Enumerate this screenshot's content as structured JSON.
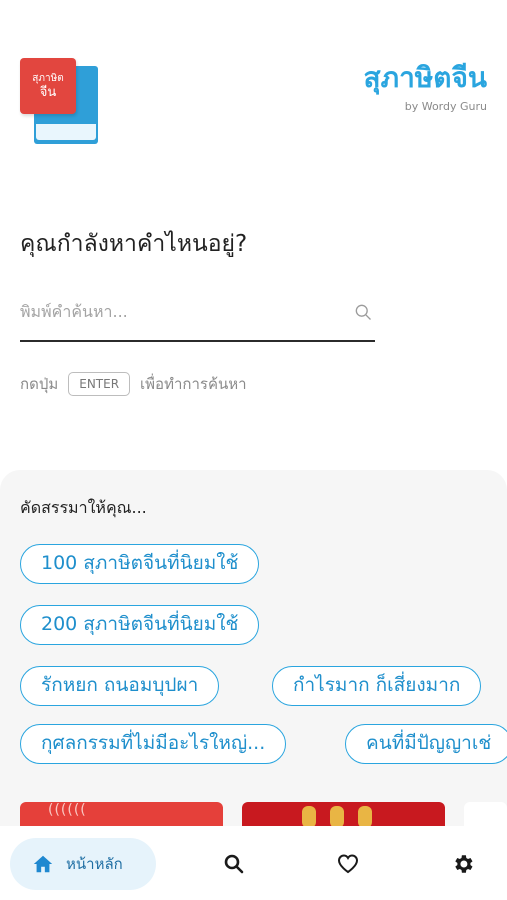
{
  "header": {
    "logo_line1": "สุภาษิต",
    "logo_line2": "จีน",
    "app_title": "สุภาษิตจีน",
    "byline": "by Wordy Guru"
  },
  "search": {
    "question": "คุณกำลังหาคำไหนอยู่?",
    "placeholder": "พิมพ์คำค้นหา...",
    "hint_before": "กดปุ่ม",
    "hint_key": "ENTER",
    "hint_after": "เพื่อทำการค้นหา"
  },
  "recommend": {
    "heading": "คัดสรรมาให้คุณ...",
    "chips": [
      "100 สุภาษิตจีนที่นิยมใช้",
      "200 สุภาษิตจีนที่นิยมใช้",
      "รักหยก ถนอมบุปผา",
      "กำไรมาก ก็เสี่ยงมาก",
      "กุศลกรรมที่ไม่มีอะไรใหญ่...",
      "คนที่มีปัญญาเช่"
    ]
  },
  "nav": {
    "home_label": "หน้าหลัก",
    "icons": [
      "home-icon",
      "search-icon",
      "heart-icon",
      "gear-icon"
    ]
  },
  "colors": {
    "accent": "#2aa5df",
    "logo_red": "#e2463f",
    "nav_active_bg": "#e6f3fb"
  }
}
